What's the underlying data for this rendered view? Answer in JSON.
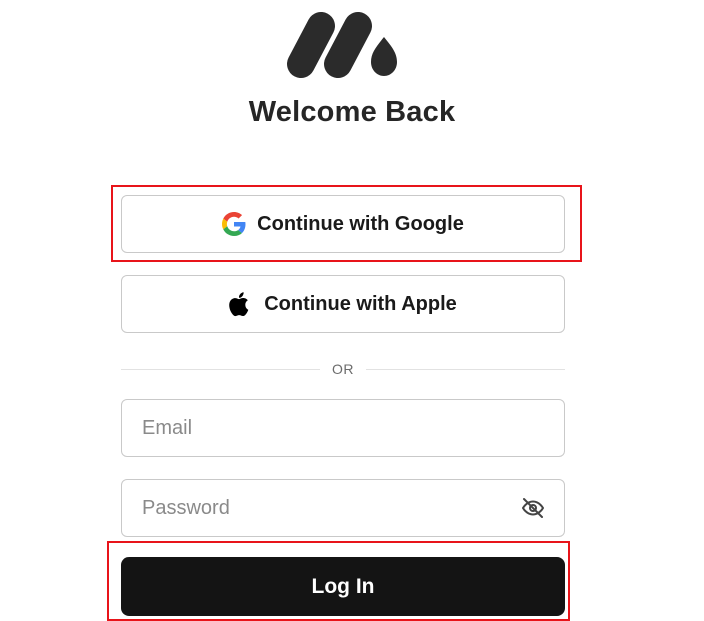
{
  "brand": {
    "logo_icon": "brand-logo-icon",
    "color": "#2b2b2b"
  },
  "header": {
    "title": "Welcome Back"
  },
  "social": {
    "google_label": "Continue with Google",
    "google_icon": "google-icon",
    "apple_label": "Continue with Apple",
    "apple_icon": "apple-icon"
  },
  "divider": {
    "label": "OR"
  },
  "form": {
    "email": {
      "placeholder": "Email",
      "value": ""
    },
    "password": {
      "placeholder": "Password",
      "value": "",
      "toggle_icon": "eye-off-icon"
    },
    "login_label": "Log In"
  },
  "annotations": {
    "highlight_color": "#e8141a"
  },
  "colors": {
    "primary_button": "#141414",
    "border": "#c9c9c9",
    "placeholder": "#8a8a8a"
  }
}
